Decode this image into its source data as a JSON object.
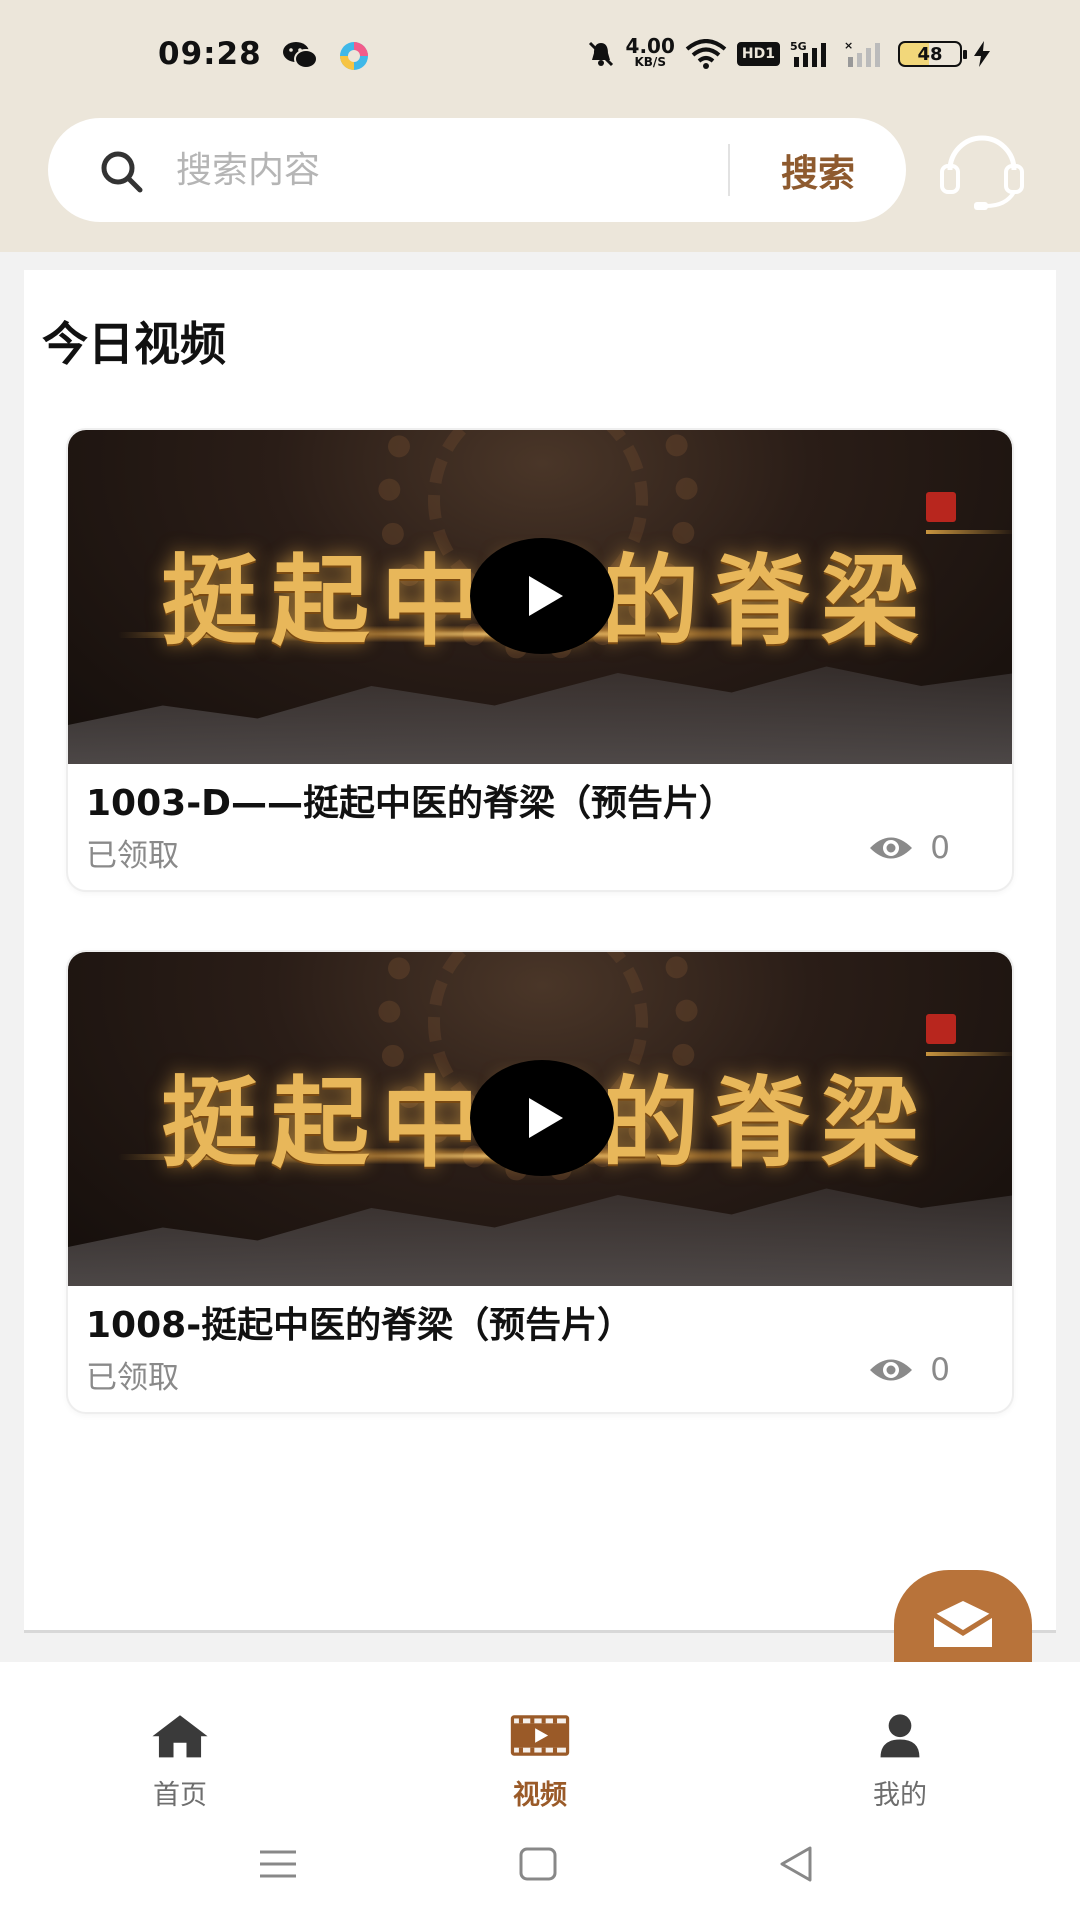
{
  "status_bar": {
    "time": "09:28",
    "net_speed_value": "4.00",
    "net_speed_unit": "KB/S",
    "hd_label": "HD1",
    "network_label": "5G",
    "battery_level": "48",
    "icons": [
      "wechat-icon",
      "colorful-app-icon",
      "mute-bell-icon",
      "wifi-icon",
      "signal-icon",
      "signal-weak-icon",
      "charging-icon"
    ]
  },
  "search": {
    "placeholder": "搜索内容",
    "button_label": "搜索"
  },
  "section": {
    "title": "今日视频"
  },
  "videos": [
    {
      "thumbnail_text": "挺起中医的脊梁",
      "title": "1003-D——挺起中医的脊梁（预告片）",
      "status": "已领取",
      "views": "0"
    },
    {
      "thumbnail_text": "挺起中医的脊梁",
      "title": "1008-挺起中医的脊梁（预告片）",
      "status": "已领取",
      "views": "0"
    }
  ],
  "tabs": [
    {
      "label": "首页",
      "icon": "home-icon",
      "active": false
    },
    {
      "label": "视频",
      "icon": "video-icon",
      "active": true
    },
    {
      "label": "我的",
      "icon": "user-icon",
      "active": false
    }
  ],
  "colors": {
    "accent": "#9a5a28",
    "header_bg": "#ece6da",
    "fab_bg": "#b8733a"
  }
}
